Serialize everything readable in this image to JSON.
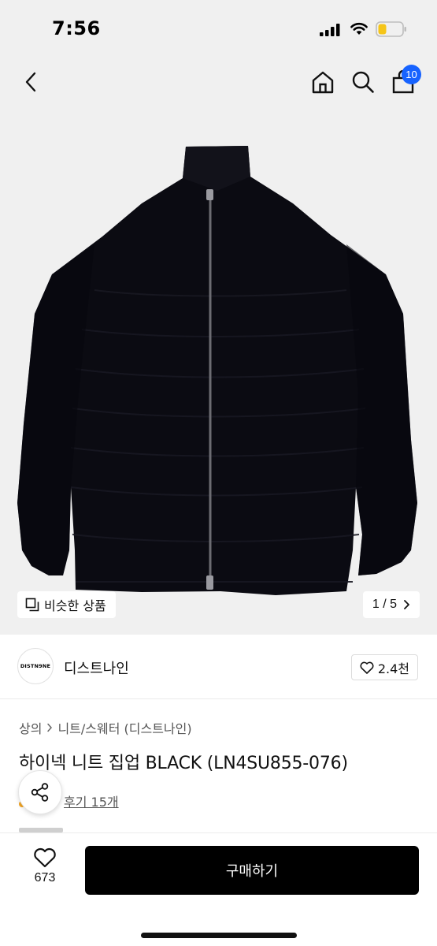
{
  "status_bar": {
    "time": "7:56"
  },
  "header": {
    "icons": [
      "back-icon",
      "home-icon",
      "search-icon",
      "cart-icon"
    ],
    "cart_badge": "10",
    "badge_color": "#1763ff"
  },
  "hero": {
    "similar_label": "비슷한 상품",
    "pager_text": "1 / 5",
    "background_color": "#f0f0f0"
  },
  "brand": {
    "logo_text": "DISTN9NE",
    "name": "디스트나인",
    "like_count": "2.4천"
  },
  "product": {
    "breadcrumb": [
      "상의",
      "니트/스웨터 (디스트나인)"
    ],
    "title": "하이넥 니트 집업 BLACK (LN4SU855-076)",
    "review_text": "후기 15개"
  },
  "bottom_bar": {
    "wish_count": "673",
    "buy_label": "구매하기"
  }
}
